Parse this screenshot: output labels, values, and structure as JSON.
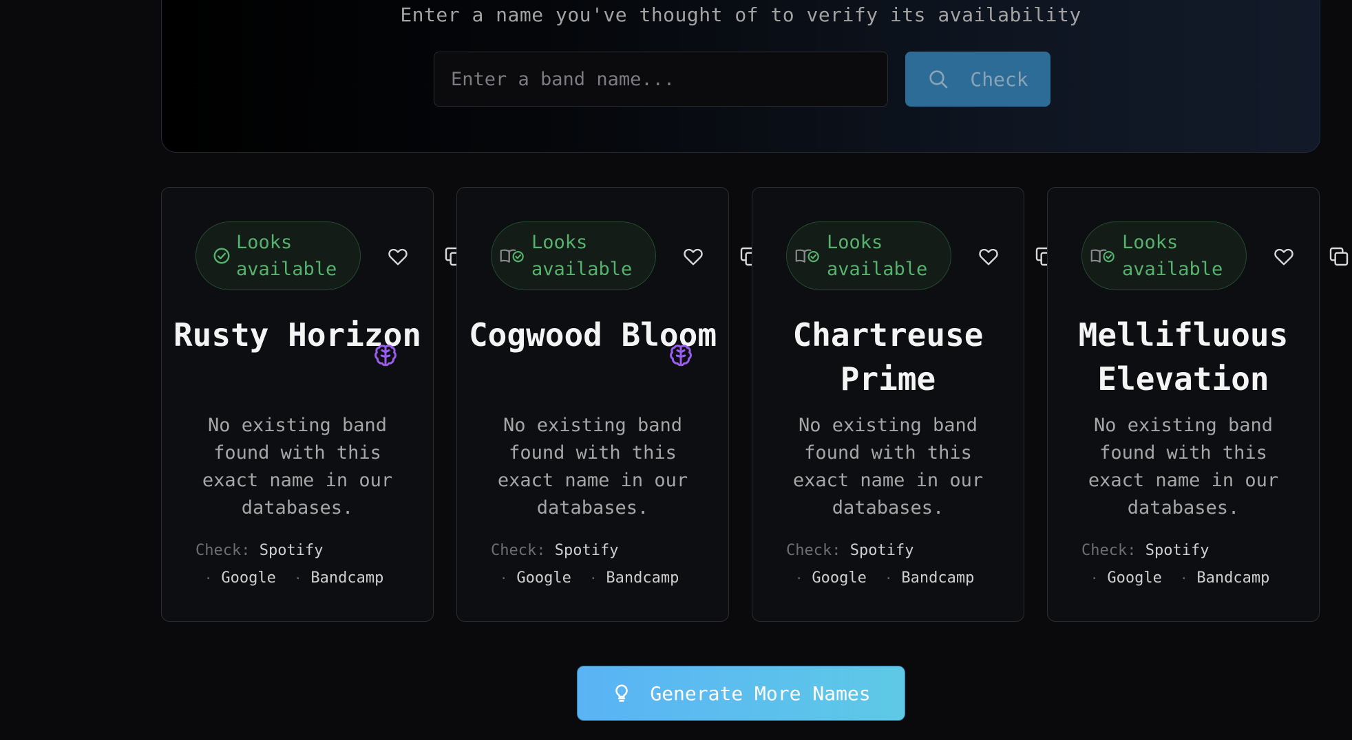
{
  "search": {
    "subtitle": "Enter a name you've thought of to verify its availability",
    "placeholder": "Enter a band name...",
    "check_label": "Check"
  },
  "cards": [
    {
      "status": "Looks available",
      "status_icon": "check-circle-icon",
      "name": "Rusty Horizon",
      "has_brain_icon": true,
      "description": "No existing band found with this exact name in our databases.",
      "check_label": "Check:",
      "links": [
        "Spotify",
        "Google",
        "Bandcamp"
      ]
    },
    {
      "status": "Looks available",
      "status_icon": "book-check-icon",
      "name": "Cogwood Bloom",
      "has_brain_icon": true,
      "description": "No existing band found with this exact name in our databases.",
      "check_label": "Check:",
      "links": [
        "Spotify",
        "Google",
        "Bandcamp"
      ]
    },
    {
      "status": "Looks available",
      "status_icon": "book-check-icon",
      "name": "Chartreuse Prime",
      "has_brain_icon": false,
      "description": "No existing band found with this exact name in our databases.",
      "check_label": "Check:",
      "links": [
        "Spotify",
        "Google",
        "Bandcamp"
      ]
    },
    {
      "status": "Looks available",
      "status_icon": "book-check-icon",
      "name": "Mellifluous Elevation",
      "has_brain_icon": false,
      "description": "No existing band found with this exact name in our databases.",
      "check_label": "Check:",
      "links": [
        "Spotify",
        "Google",
        "Bandcamp"
      ]
    }
  ],
  "generate_label": "Generate More Names",
  "colors": {
    "accent_blue": "#5ab3f5",
    "available_green": "#56b26d",
    "brain_purple": "#9b5cf0"
  }
}
